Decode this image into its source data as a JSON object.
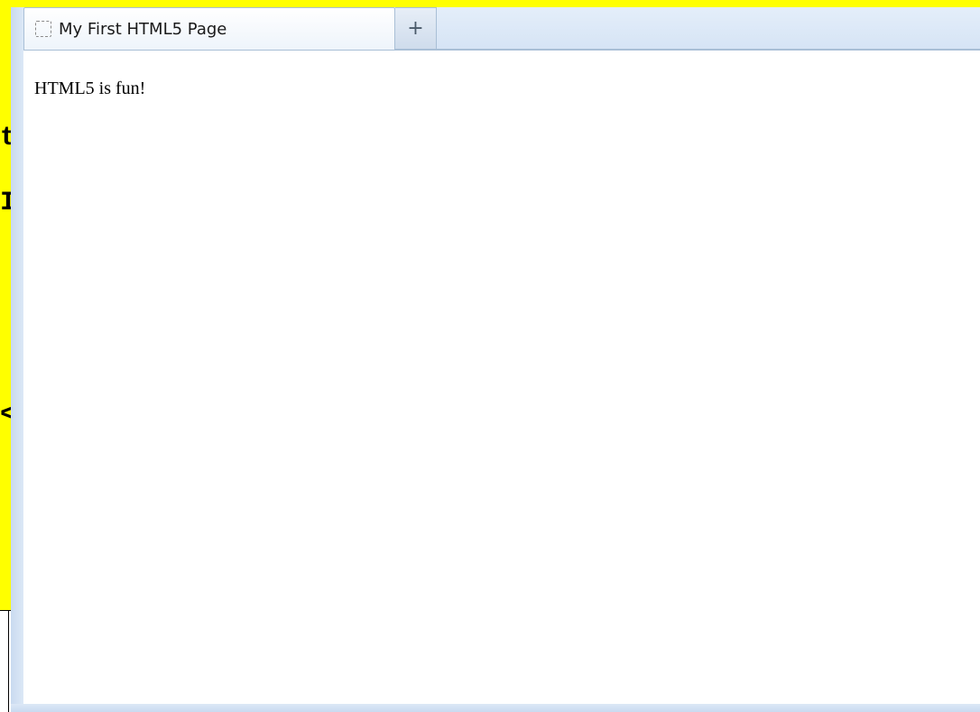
{
  "background_editor": {
    "fragments": [
      "t",
      "I",
      "<"
    ]
  },
  "browser": {
    "tabs": [
      {
        "title": "My First HTML5 Page",
        "icon": "page-icon"
      }
    ],
    "new_tab_label": "+",
    "page": {
      "text": "HTML5 is fun!"
    }
  },
  "colors": {
    "background_editor": "#ffff00",
    "frame": "#d6e3f3",
    "page_background": "#ffffff"
  }
}
